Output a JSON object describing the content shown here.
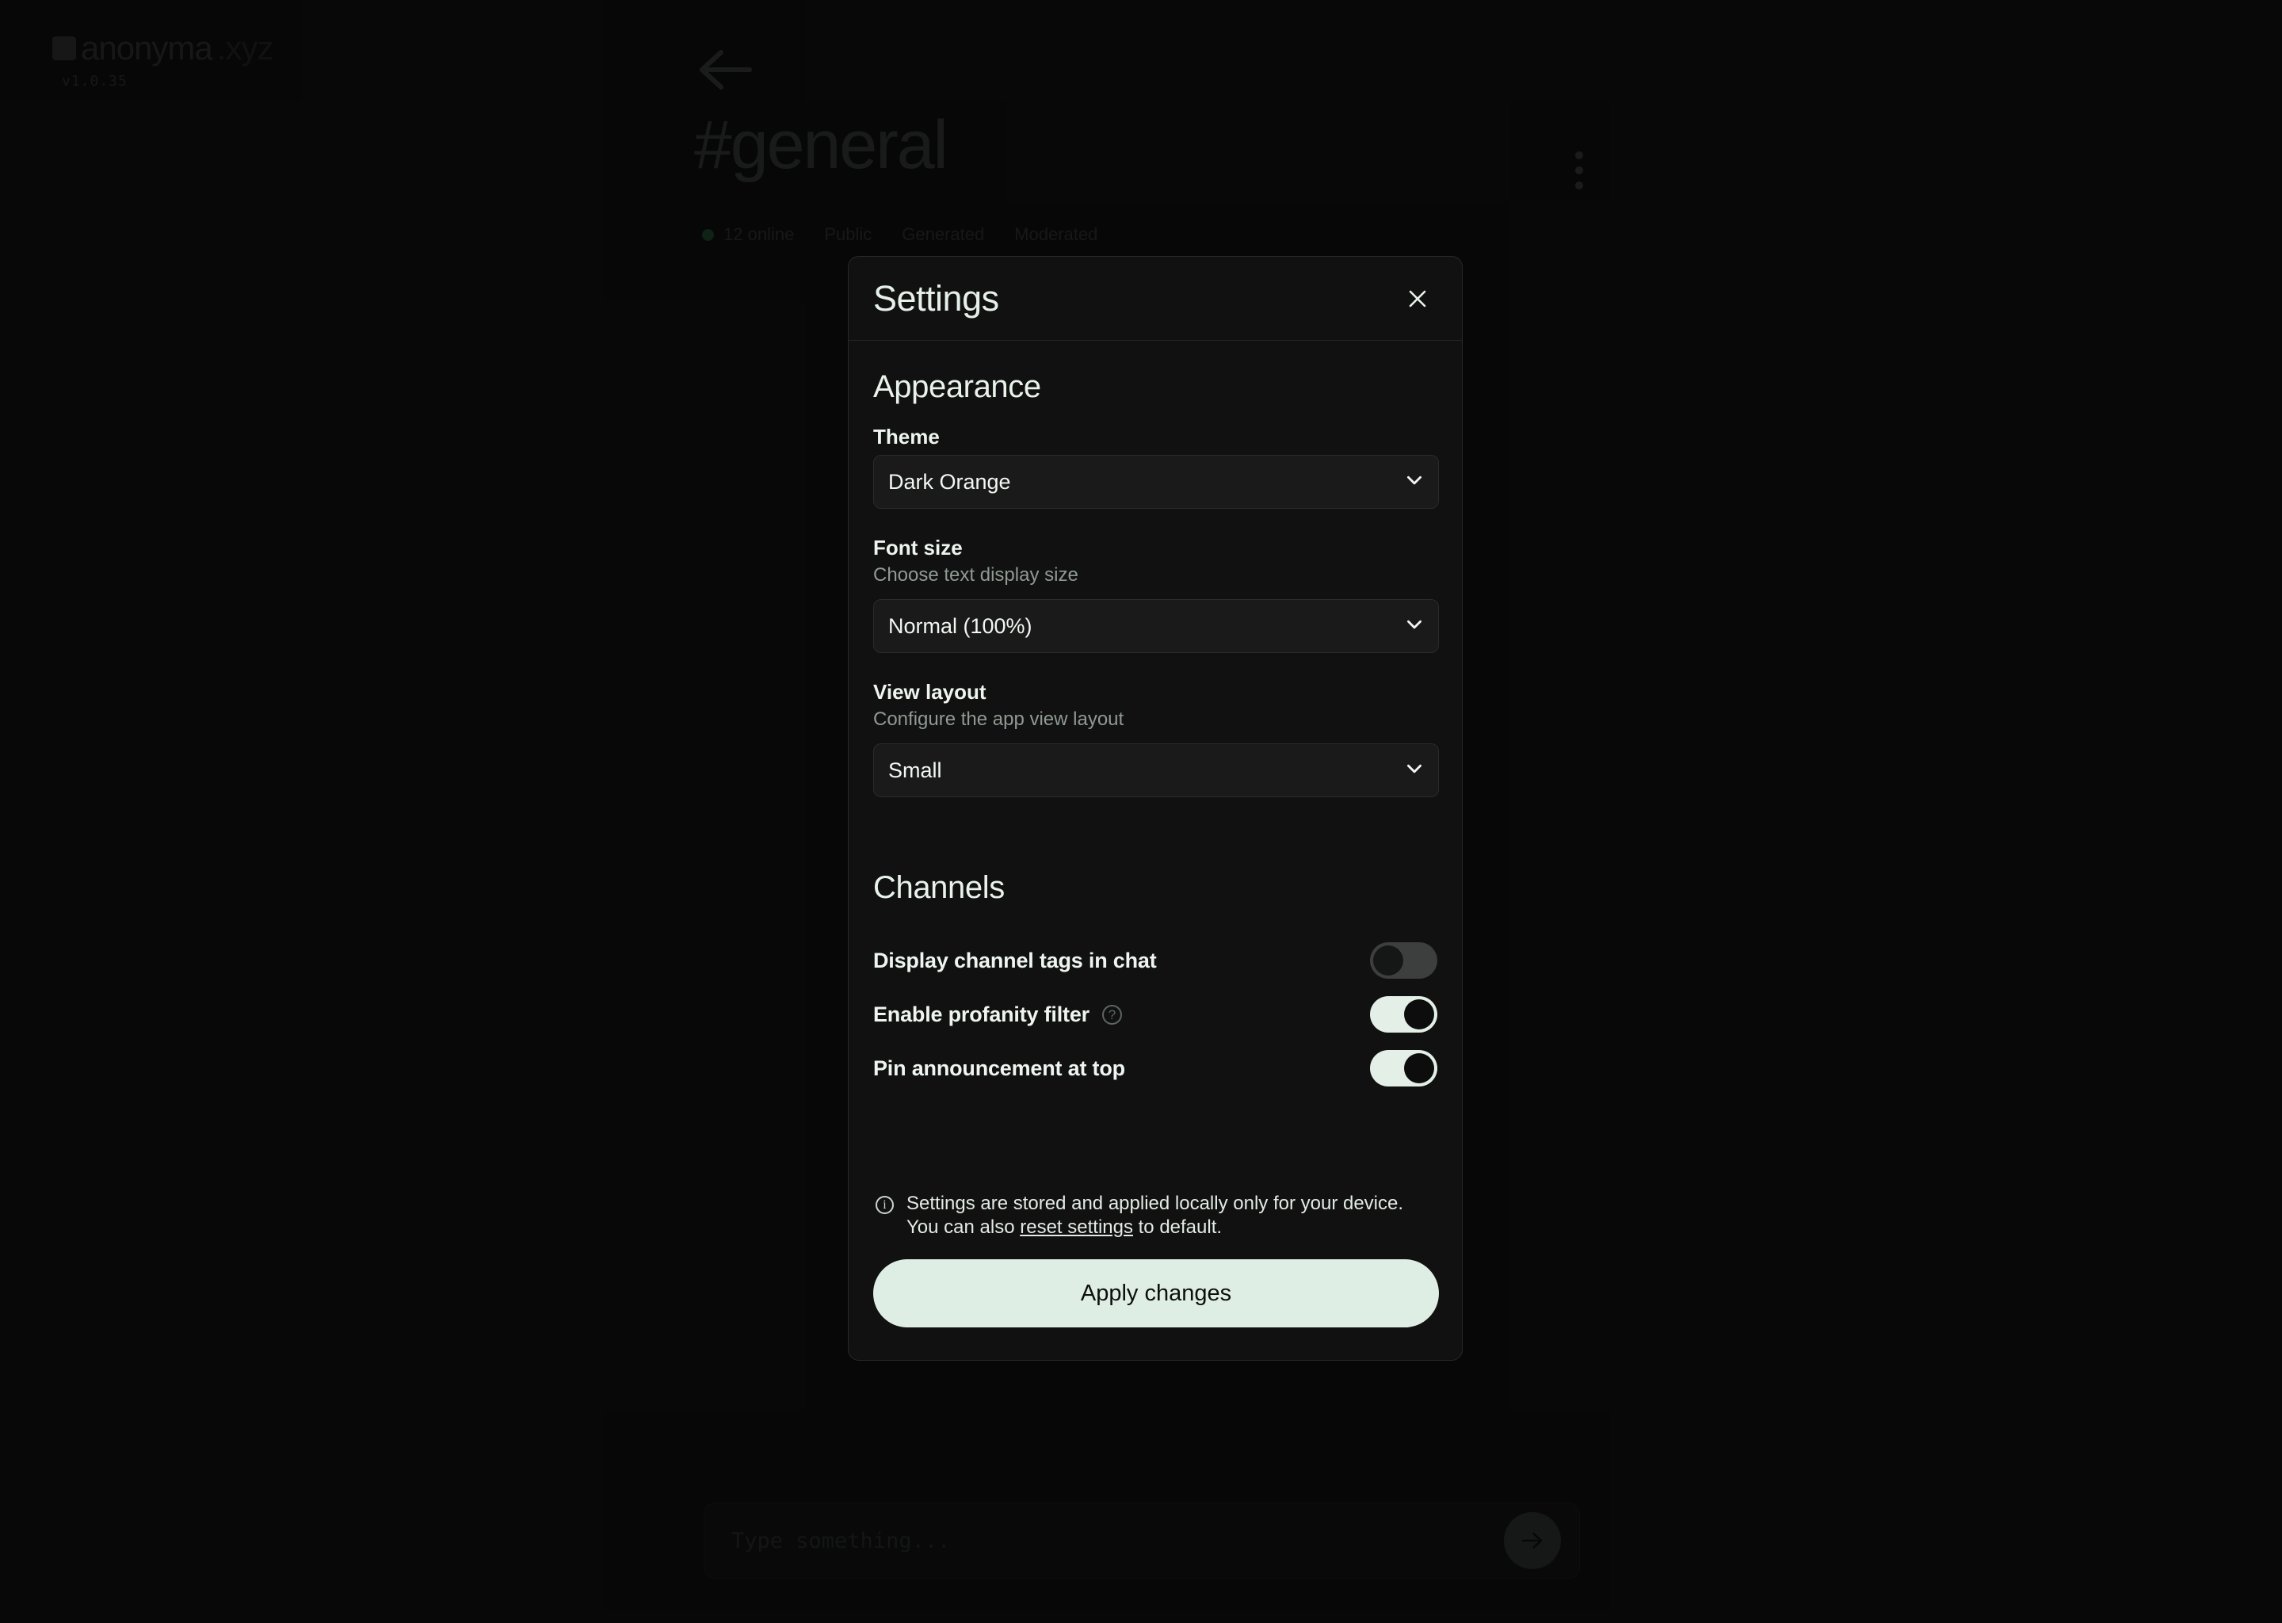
{
  "brand": {
    "name": "anonyma",
    "tld": ".xyz",
    "version": "v1.0.35"
  },
  "channel": {
    "title": "#general",
    "online": "12 online",
    "tags": [
      "Public",
      "Generated",
      "Moderated"
    ]
  },
  "composer": {
    "placeholder": "Type something...",
    "value": ""
  },
  "dialog": {
    "title": "Settings",
    "close_label": "✕",
    "sections": {
      "appearance": {
        "heading": "Appearance",
        "theme": {
          "label": "Theme",
          "value": "Dark Orange",
          "options": [
            "Dark Orange"
          ]
        },
        "font_size": {
          "label": "Font size",
          "description": "Choose text display size",
          "value": "Normal (100%)",
          "options": [
            "Normal (100%)"
          ]
        },
        "view_layout": {
          "label": "View layout",
          "description": "Configure the app view layout",
          "value": "Small",
          "options": [
            "Small"
          ]
        }
      },
      "channels": {
        "heading": "Channels",
        "toggles": [
          {
            "label": "Display channel tags in chat",
            "state": "off",
            "has_help": false
          },
          {
            "label": "Enable profanity filter",
            "state": "on",
            "has_help": true
          },
          {
            "label": "Pin announcement at top",
            "state": "on",
            "has_help": false
          }
        ]
      }
    },
    "footnote": {
      "line1": "Settings are stored and applied locally only for your device.",
      "line2_prefix": "You can also ",
      "link": "reset settings",
      "line2_suffix": " to default."
    },
    "apply_label": "Apply changes"
  },
  "colors": {
    "accent": "#dfeee4",
    "background": "#0b0b0b",
    "dialog_bg": "#101110",
    "online_dot": "#1d4429"
  }
}
